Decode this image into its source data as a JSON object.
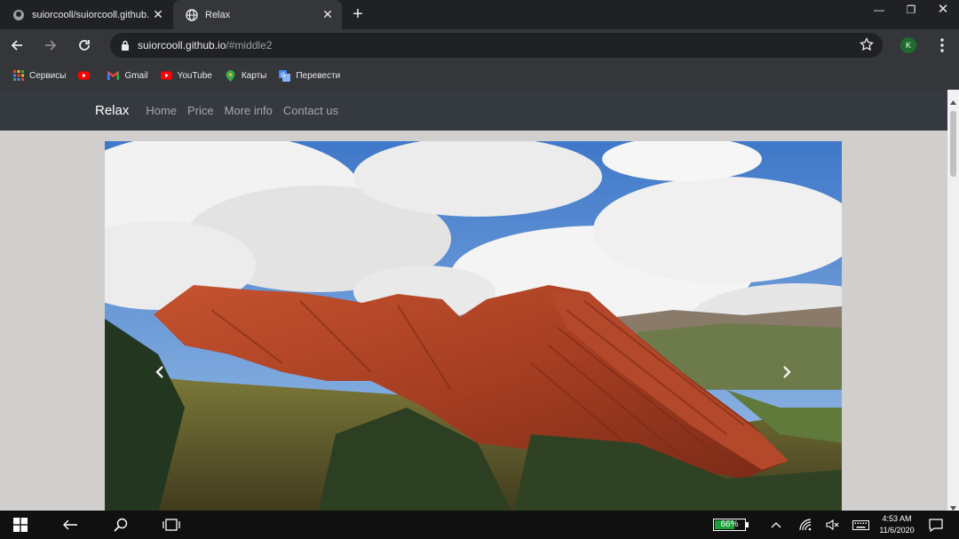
{
  "tabs": [
    {
      "title": "suiorcooll/suiorcooll.github.io",
      "icon": "github-icon",
      "active": false
    },
    {
      "title": "Relax",
      "icon": "globe-icon",
      "active": true
    }
  ],
  "omnibox": {
    "host": "suiorcooll.github.io",
    "path": "/#middle2"
  },
  "profile_initial": "K",
  "bookmarks": [
    {
      "label": "Сервисы",
      "icon": "apps-grid-icon"
    },
    {
      "label": "",
      "icon": "youtube-icon"
    },
    {
      "label": "Gmail",
      "icon": "gmail-icon"
    },
    {
      "label": "YouTube",
      "icon": "youtube-icon"
    },
    {
      "label": "Карты",
      "icon": "maps-icon"
    },
    {
      "label": "Перевести",
      "icon": "translate-icon"
    }
  ],
  "site": {
    "brand": "Relax",
    "nav": [
      "Home",
      "Price",
      "More info",
      "Contact us"
    ]
  },
  "taskbar": {
    "battery": 66,
    "battery_label": "66%",
    "time": "4:53 AM",
    "date": "11/6/2020"
  },
  "colors": {
    "navbar": "#343a40",
    "page_bg": "#d0cfcd",
    "chrome_dark": "#202124",
    "chrome_toolbar": "#35363a"
  }
}
